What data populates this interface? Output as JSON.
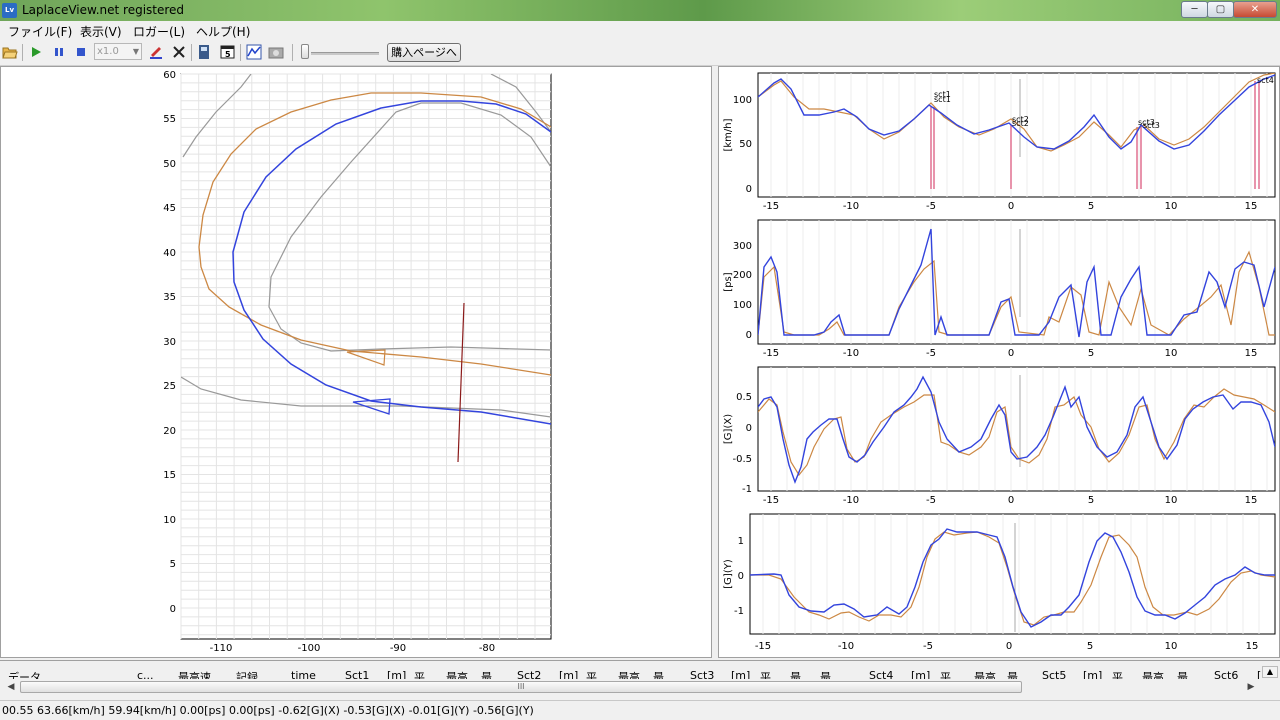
{
  "window": {
    "title": "LaplaceView.net registered",
    "app_icon": "Lv",
    "buttons": {
      "minimize": "─",
      "maximize": "▢",
      "close": "✕"
    }
  },
  "menu": {
    "items": [
      {
        "label": "ファイル(F)"
      },
      {
        "label": "表示(V)"
      },
      {
        "label": "ロガー(L)"
      },
      {
        "label": "ヘルプ(H)"
      }
    ]
  },
  "toolbar": {
    "speed_value": "x1.0",
    "buy_label": "購入ページへ",
    "icons": [
      "folder-open-icon",
      "play-icon",
      "pause-icon",
      "stop-icon",
      "marker-pen-icon",
      "clear-x-icon",
      "export-icon",
      "window-icon",
      "graph-icon",
      "camera-icon"
    ],
    "slider_level": 0
  },
  "map": {
    "x_ticks": [
      "-110",
      "-100",
      "-90",
      "-80"
    ],
    "y_ticks": [
      "60",
      "55",
      "50",
      "45",
      "40",
      "35",
      "30",
      "25",
      "20",
      "15",
      "10",
      "5",
      "0"
    ],
    "colors": {
      "lap_blue": "#3344dd",
      "lap_orange": "#cc8844",
      "track_gray": "#999999",
      "cursor_line": "#8b1a1a"
    }
  },
  "graphs": {
    "x_ticks": [
      "-15",
      "-10",
      "-5",
      "0",
      "5",
      "10",
      "15"
    ],
    "charts": [
      {
        "ylabel": "[km/h]",
        "y_ticks": [
          "100",
          "50",
          "0"
        ]
      },
      {
        "ylabel": "[ps]",
        "y_ticks": [
          "300",
          "200",
          "100",
          "0"
        ]
      },
      {
        "ylabel": "[G](X)",
        "y_ticks": [
          "0.5",
          "0",
          "-0.5",
          "-1"
        ]
      },
      {
        "ylabel": "[G](Y)",
        "y_ticks": [
          "1",
          "0",
          "-1"
        ]
      }
    ],
    "sector_labels": [
      "sct1",
      "sct1",
      "sct2",
      "sct2",
      "sct3",
      "sct3",
      "sct4"
    ],
    "colors": {
      "blue": "#3344dd",
      "orange": "#cc8844",
      "sector": "#e07090"
    }
  },
  "table": {
    "columns": [
      "データ",
      "c...",
      "最高速",
      "記録",
      "time",
      "Sct1",
      "[m]",
      "平...",
      "最高",
      "最...",
      "Sct2",
      "[m]",
      "平...",
      "最高",
      "最...",
      "Sct3",
      "[m]",
      "平...",
      "最...",
      "最...",
      "Sct4",
      "[m]",
      "平...",
      "最高",
      "最...",
      "Sct5",
      "[m]",
      "平...",
      "最高",
      "最...",
      "Sct6",
      "["
    ],
    "scroll_grip": "III"
  },
  "status": {
    "text": "00.55 63.66[km/h] 59.94[km/h]  0.00[ps]  0.00[ps]  -0.62[G](X) -0.53[G](X)  -0.01[G](Y) -0.56[G](Y)"
  }
}
